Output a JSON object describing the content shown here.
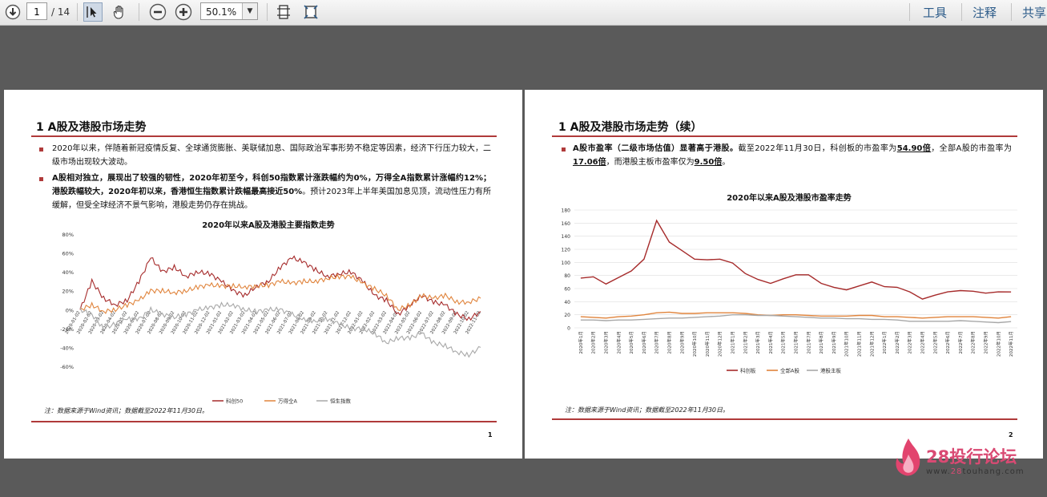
{
  "toolbar": {
    "page_current": "1",
    "page_total": "/ 14",
    "zoom": "50.1%",
    "menu": [
      "工具",
      "注释",
      "共享"
    ]
  },
  "page1": {
    "title": "1  A股及港股市场走势",
    "bullet1": "2020年以来，伴随着新冠疫情反复、全球通货膨胀、美联储加息、国际政治军事形势不稳定等因素，经济下行压力较大，二级市场出现较大波动。",
    "bullet2_a": "A股相对独立，展现出了较强的韧性，",
    "bullet2_b": "2020年初至今，科创50指数累计涨跌幅约为0%，万得全A指数累计涨幅约12%；港股跌幅较大，2020年初以来，香港恒生指数累计跌幅最高接近50%",
    "bullet2_c": "。预计2023年上半年美国加息见顶，流动性压力有所缓解，但受全球经济不景气影响，港股走势仍存在挑战。",
    "note": "注：数据来源于Wind资讯；数据截至2022年11月30日。",
    "page_number": "1"
  },
  "page2": {
    "title": "1  A股及港股市场走势（续）",
    "bullet1_a": "A股市盈率（二级市场估值）显著高于港股。",
    "bullet1_b": "截至2022年11月30日，科创板的市盈率为",
    "pe_star": "54.90倍",
    "bullet1_c": "，全部A股的市盈率为",
    "pe_all_a": "17.06倍",
    "bullet1_d": "，而港股主板市盈率仅为",
    "pe_hk": "9.50倍",
    "bullet1_e": "。",
    "note": "注：数据来源于Wind资讯；数据截至2022年11月30日。",
    "page_number": "2"
  },
  "watermark": {
    "brand": "28投行论坛",
    "url_a": "www.",
    "url_b": "28",
    "url_c": "touhang.com"
  },
  "chart_data": [
    {
      "type": "line",
      "title": "2020年以来A股及港股主要指数走势",
      "ylim": [
        -0.6,
        0.8
      ],
      "yticks": [
        "80%",
        "60%",
        "40%",
        "20%",
        "0%",
        "-20%",
        "-40%",
        "-60%"
      ],
      "x_labels": [
        "2020-01-02",
        "2020-02-02",
        "2020-03-02",
        "2020-04-02",
        "2020-05-02",
        "2020-06-02",
        "2020-07-02",
        "2020-08-02",
        "2020-09-02",
        "2020-10-02",
        "2020-11-02",
        "2020-12-02",
        "2021-01-02",
        "2021-02-02",
        "2021-03-02",
        "2021-04-02",
        "2021-05-02",
        "2021-06-02",
        "2021-07-02",
        "2021-08-02",
        "2021-09-02",
        "2021-10-02",
        "2021-11-02",
        "2021-12-02",
        "2022-01-02",
        "2022-02-02",
        "2022-03-02",
        "2022-04-02",
        "2022-05-02",
        "2022-06-02",
        "2022-07-02",
        "2022-08-02",
        "2022-09-02",
        "2022-10-02",
        "2022-11-02"
      ],
      "series": [
        {
          "name": "科创50",
          "color": "#a62b2b",
          "values": [
            0.0,
            0.3,
            0.12,
            0.05,
            0.1,
            0.3,
            0.55,
            0.4,
            0.45,
            0.35,
            0.4,
            0.38,
            0.3,
            0.2,
            0.15,
            0.25,
            0.3,
            0.45,
            0.55,
            0.5,
            0.42,
            0.35,
            0.38,
            0.4,
            0.3,
            0.15,
            0.1,
            -0.05,
            0.05,
            0.15,
            0.08,
            0.05,
            -0.05,
            -0.1,
            -0.02
          ]
        },
        {
          "name": "万得全A",
          "color": "#e0843c",
          "values": [
            0.0,
            0.05,
            -0.02,
            0.0,
            0.05,
            0.1,
            0.2,
            0.2,
            0.18,
            0.2,
            0.24,
            0.26,
            0.25,
            0.25,
            0.24,
            0.25,
            0.26,
            0.3,
            0.28,
            0.3,
            0.3,
            0.33,
            0.35,
            0.35,
            0.28,
            0.22,
            0.15,
            0.0,
            0.05,
            0.15,
            0.12,
            0.15,
            0.08,
            0.08,
            0.12
          ]
        },
        {
          "name": "恒生指数",
          "color": "#a8a8a8",
          "values": [
            0.0,
            -0.05,
            -0.2,
            -0.15,
            -0.1,
            -0.1,
            0.0,
            -0.05,
            -0.08,
            -0.05,
            0.0,
            0.02,
            0.05,
            0.05,
            0.0,
            -0.02,
            0.0,
            0.0,
            -0.05,
            -0.1,
            -0.12,
            -0.1,
            -0.15,
            -0.2,
            -0.2,
            -0.25,
            -0.35,
            -0.3,
            -0.3,
            -0.25,
            -0.35,
            -0.38,
            -0.45,
            -0.48,
            -0.4
          ]
        }
      ]
    },
    {
      "type": "line",
      "title": "2020年以来A股及港股市盈率走势",
      "ylim": [
        0,
        180
      ],
      "yticks": [
        0,
        20,
        40,
        60,
        80,
        100,
        120,
        140,
        160,
        180
      ],
      "x": [
        "2020年1月",
        "2020年2月",
        "2020年3月",
        "2020年4月",
        "2020年5月",
        "2020年6月",
        "2020年7月",
        "2020年8月",
        "2020年9月",
        "2020年10月",
        "2020年11月",
        "2020年12月",
        "2021年1月",
        "2021年2月",
        "2021年3月",
        "2021年4月",
        "2021年5月",
        "2021年6月",
        "2021年7月",
        "2021年8月",
        "2021年9月",
        "2021年10月",
        "2021年11月",
        "2021年12月",
        "2022年1月",
        "2022年2月",
        "2022年3月",
        "2022年4月",
        "2022年5月",
        "2022年6月",
        "2022年7月",
        "2022年8月",
        "2022年9月",
        "2022年10月",
        "2022年11月"
      ],
      "series": [
        {
          "name": "科创板",
          "color": "#a62b2b",
          "values": [
            76,
            78,
            67,
            77,
            87,
            105,
            164,
            131,
            118,
            105,
            104,
            105,
            99,
            83,
            74,
            68,
            75,
            81,
            81,
            68,
            62,
            58,
            64,
            70,
            63,
            62,
            55,
            44,
            50,
            55,
            57,
            56,
            53,
            55,
            54.9
          ]
        },
        {
          "name": "全部A股",
          "color": "#e0843c",
          "values": [
            17,
            16,
            15,
            17,
            18,
            20,
            23,
            24,
            22,
            22,
            23,
            23,
            23,
            22,
            20,
            19,
            20,
            20,
            19,
            18,
            18,
            18,
            19,
            19,
            17,
            17,
            16,
            15,
            16,
            17,
            17,
            17,
            16,
            15,
            17.06
          ]
        },
        {
          "name": "港股主板",
          "color": "#a8a8a8",
          "values": [
            12,
            12,
            11,
            12,
            12,
            13,
            14,
            15,
            15,
            16,
            17,
            18,
            20,
            20,
            19,
            19,
            18,
            17,
            16,
            15,
            15,
            14,
            14,
            13,
            13,
            12,
            10,
            10,
            10,
            10,
            11,
            10,
            9,
            8,
            9.5
          ]
        }
      ]
    }
  ]
}
